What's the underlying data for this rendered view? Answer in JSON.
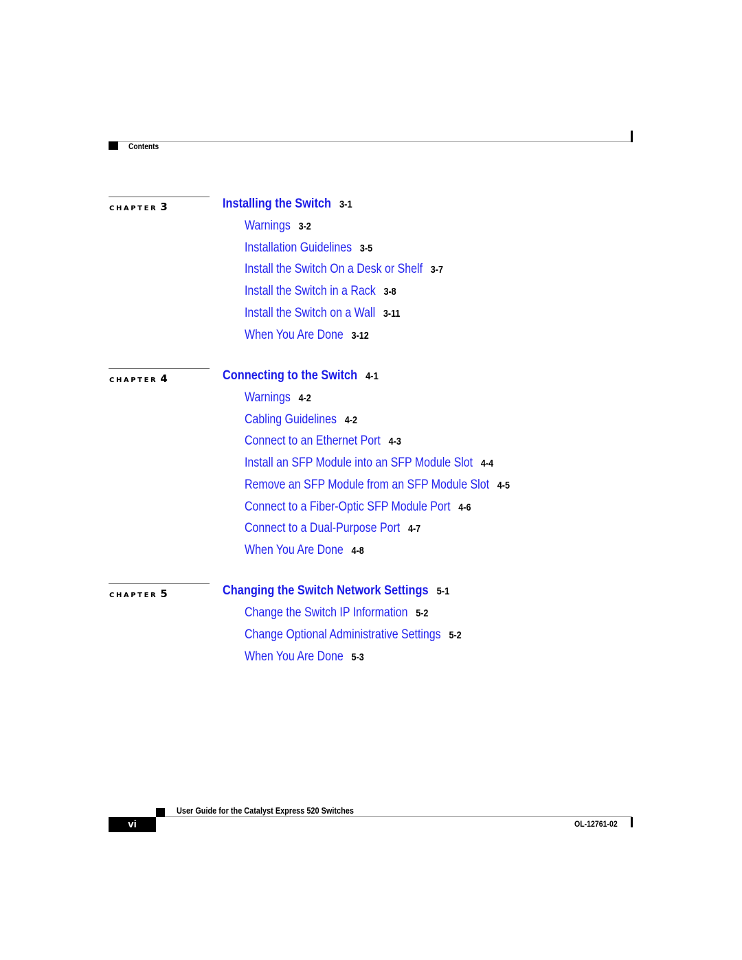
{
  "header": {
    "section_label": "Contents"
  },
  "colors": {
    "link_blue": "#2222ee",
    "chapter_blue": "#1a1ae6",
    "text": "#000000"
  },
  "chapters": [
    {
      "label": "CHAPTER",
      "number": "3",
      "title": "Installing the Switch",
      "page": "3-1",
      "entries": [
        {
          "title": "Warnings",
          "page": "3-2"
        },
        {
          "title": "Installation Guidelines",
          "page": "3-5"
        },
        {
          "title": "Install the Switch On a Desk or Shelf",
          "page": "3-7"
        },
        {
          "title": "Install the Switch in a Rack",
          "page": "3-8"
        },
        {
          "title": "Install the Switch on a Wall",
          "page": "3-11"
        },
        {
          "title": "When You Are Done",
          "page": "3-12"
        }
      ]
    },
    {
      "label": "CHAPTER",
      "number": "4",
      "title": "Connecting to the Switch",
      "page": "4-1",
      "entries": [
        {
          "title": "Warnings",
          "page": "4-2"
        },
        {
          "title": "Cabling Guidelines",
          "page": "4-2"
        },
        {
          "title": "Connect to an Ethernet Port",
          "page": "4-3"
        },
        {
          "title": "Install an SFP Module into an SFP Module Slot",
          "page": "4-4"
        },
        {
          "title": "Remove an SFP Module from an SFP Module Slot",
          "page": "4-5"
        },
        {
          "title": "Connect to a Fiber-Optic SFP Module Port",
          "page": "4-6"
        },
        {
          "title": "Connect to a Dual-Purpose Port",
          "page": "4-7"
        },
        {
          "title": "When You Are Done",
          "page": "4-8"
        }
      ]
    },
    {
      "label": "CHAPTER",
      "number": "5",
      "title": "Changing the Switch Network Settings",
      "page": "5-1",
      "entries": [
        {
          "title": "Change the Switch IP Information",
          "page": "5-2"
        },
        {
          "title": "Change Optional Administrative Settings",
          "page": "5-2"
        },
        {
          "title": "When You Are Done",
          "page": "5-3"
        }
      ]
    }
  ],
  "footer": {
    "book_title": "User Guide for the Catalyst Express 520 Switches",
    "page_number": "vi",
    "doc_number": "OL-12761-02"
  }
}
